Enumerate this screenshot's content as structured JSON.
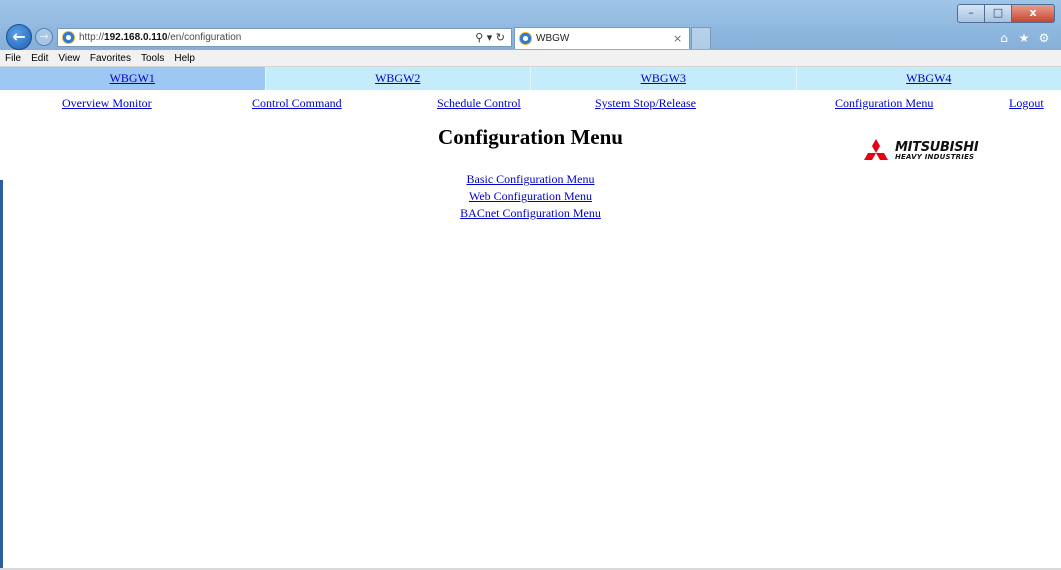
{
  "browser": {
    "address": {
      "prefix": "http://",
      "host": "192.168.0.110",
      "path": "/en/configuration"
    },
    "tab": {
      "title": "WBGW"
    },
    "window_controls": {
      "minimize": "–",
      "maximize": "□",
      "close": "x"
    },
    "icons": {
      "back": "back-arrow-icon",
      "forward": "forward-arrow-icon",
      "search": "search-icon",
      "refresh": "refresh-icon",
      "home": "home-icon",
      "favorites": "star-icon",
      "settings": "gear-icon"
    }
  },
  "menubar": {
    "items": [
      "File",
      "Edit",
      "View",
      "Favorites",
      "Tools",
      "Help"
    ]
  },
  "gateways": {
    "tabs": [
      "WBGW1",
      "WBGW2",
      "WBGW3",
      "WBGW4"
    ],
    "active_index": 0,
    "colors": {
      "active": "#9ec8f4",
      "inactive": "#c4ecfa"
    }
  },
  "nav": {
    "overview": "Overview Monitor",
    "control": "Control Command",
    "schedule": "Schedule Control",
    "system": "System Stop/Release",
    "config": "Configuration Menu",
    "logout": "Logout"
  },
  "page": {
    "title": "Configuration Menu",
    "links": {
      "basic": "Basic Configuration Menu",
      "web": "Web Configuration Menu",
      "bacnet": "BACnet Configuration Menu"
    }
  },
  "logo": {
    "name": "MITSUBISHI",
    "sub": "HEAVY INDUSTRIES",
    "color": "#e60012"
  }
}
